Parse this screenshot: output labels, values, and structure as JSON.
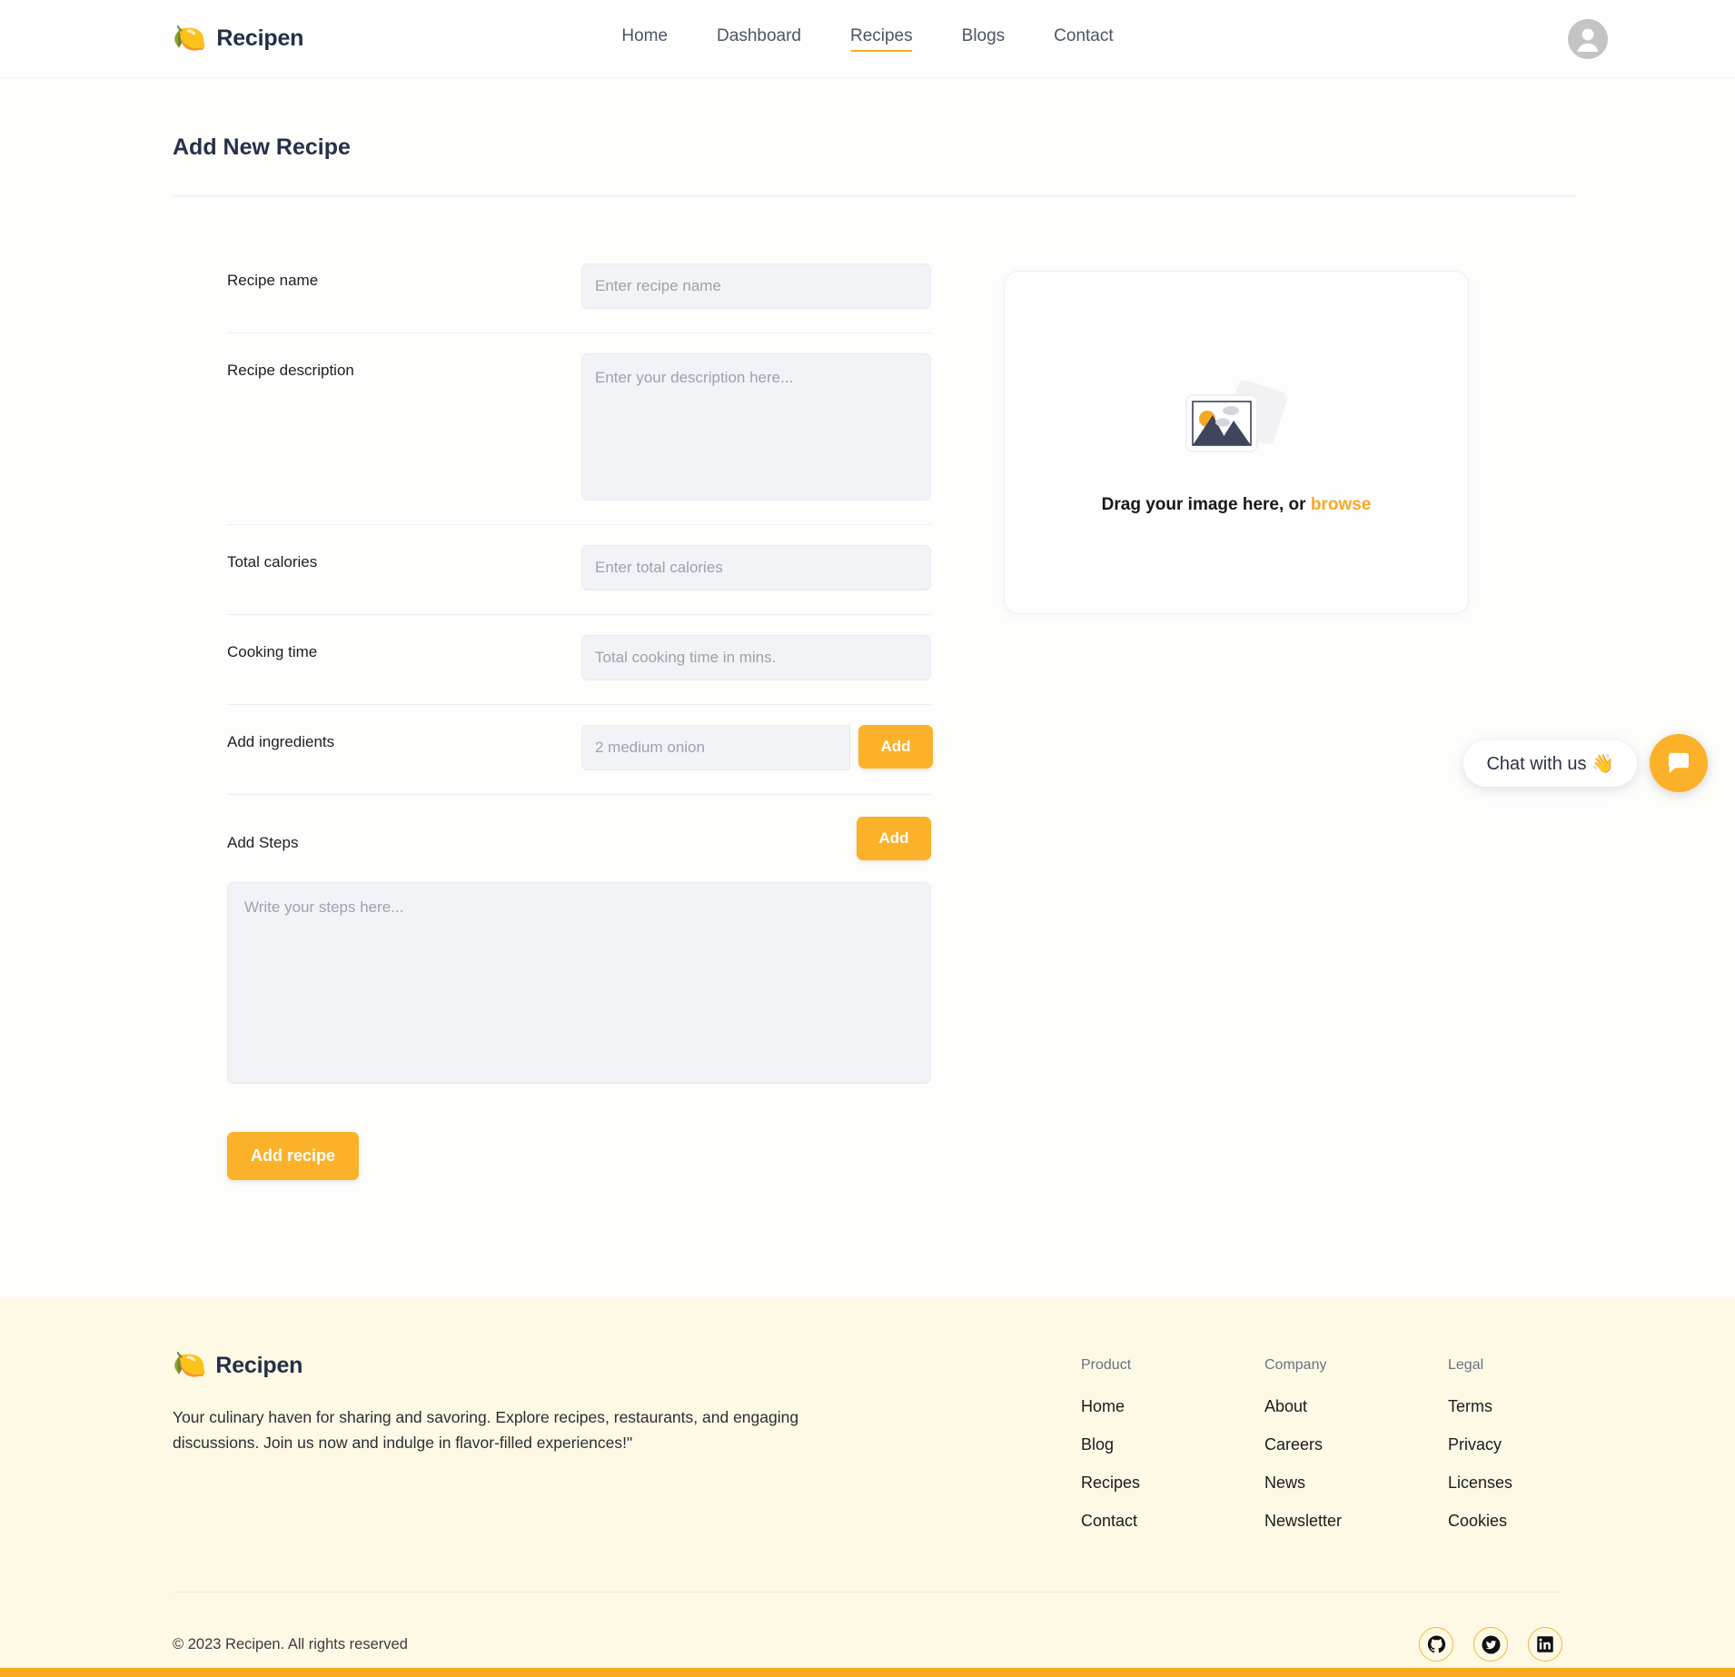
{
  "brand": {
    "name": "Recipen",
    "emoji": "🍋"
  },
  "header": {
    "nav": [
      {
        "label": "Home",
        "active": false
      },
      {
        "label": "Dashboard",
        "active": false
      },
      {
        "label": "Recipes",
        "active": true
      },
      {
        "label": "Blogs",
        "active": false
      },
      {
        "label": "Contact",
        "active": false
      }
    ]
  },
  "main": {
    "page_title": "Add New Recipe",
    "fields": {
      "recipe_name": {
        "label": "Recipe name",
        "value": "",
        "placeholder": "Enter recipe name"
      },
      "recipe_description": {
        "label": "Recipe description",
        "value": "",
        "placeholder": "Enter your description here..."
      },
      "total_calories": {
        "label": "Total calories",
        "value": "",
        "placeholder": "Enter total calories"
      },
      "cooking_time": {
        "label": "Cooking time",
        "value": "",
        "placeholder": "Total cooking time in mins."
      },
      "add_ingredients": {
        "label": "Add ingredients",
        "value": "",
        "placeholder": "2 medium onion",
        "button": "Add"
      },
      "add_steps": {
        "label": "Add Steps",
        "button": "Add",
        "value": "",
        "placeholder": "Write your steps here..."
      }
    },
    "submit_label": "Add recipe",
    "upload": {
      "text_prefix": "Drag your image here, or ",
      "browse_label": "browse",
      "icon": "image-placeholder-icon"
    }
  },
  "chat": {
    "bubble_label": "Chat with us 👋",
    "fab_icon": "chat-bubble-icon"
  },
  "footer": {
    "description": "Your culinary haven for sharing and savoring. Explore recipes, restaurants, and engaging discussions. Join us now and indulge in flavor-filled experiences!\"",
    "columns": [
      {
        "title": "Product",
        "links": [
          "Home",
          "Blog",
          "Recipes",
          "Contact"
        ]
      },
      {
        "title": "Company",
        "links": [
          "About",
          "Careers",
          "News",
          "Newsletter"
        ]
      },
      {
        "title": "Legal",
        "links": [
          "Terms",
          "Privacy",
          "Licenses",
          "Cookies"
        ]
      }
    ],
    "copyright": "© 2023 Recipen. All rights reserved",
    "socials": [
      "github-icon",
      "twitter-icon",
      "linkedin-icon"
    ]
  },
  "colors": {
    "accent": "#fbb12a",
    "accent_link": "#f9a825",
    "footer_bg": "#fdf9e5",
    "field_bg": "#f1f3f6",
    "text_dark": "#25304a"
  }
}
